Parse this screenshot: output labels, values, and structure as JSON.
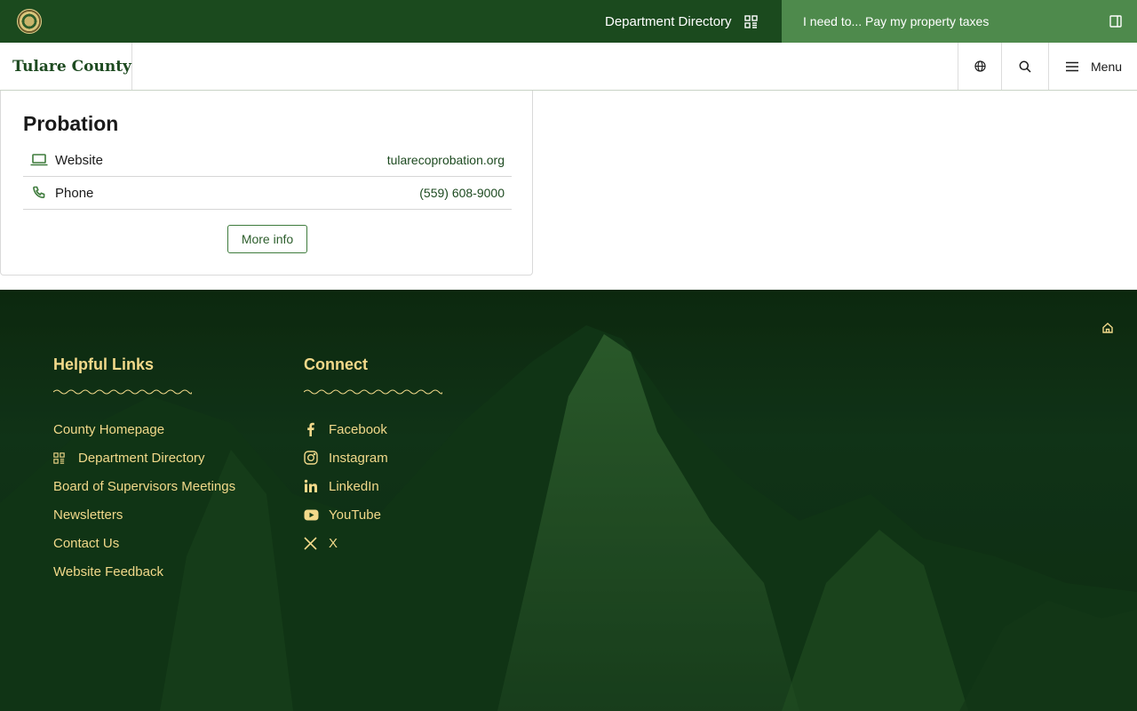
{
  "topbar": {
    "department_directory": "Department Directory",
    "i_need_to": "I need to... Pay my property taxes"
  },
  "header": {
    "brand": "Tulare County",
    "menu_label": "Menu"
  },
  "card": {
    "title": "Probation",
    "rows": [
      {
        "label": "Website",
        "value": "tularecoprobation.org",
        "icon": "laptop-icon"
      },
      {
        "label": "Phone",
        "value": "(559) 608-9000",
        "icon": "phone-icon"
      }
    ],
    "more_info": "More info"
  },
  "footer": {
    "helpful_links": {
      "heading": "Helpful Links",
      "items": [
        "County Homepage",
        "Department Directory",
        "Board of Supervisors Meetings",
        "Newsletters",
        "Contact Us",
        "Website Feedback"
      ]
    },
    "connect": {
      "heading": "Connect",
      "items": [
        "Facebook",
        "Instagram",
        "LinkedIn",
        "YouTube",
        "X"
      ]
    }
  },
  "colors": {
    "topbar": "#1b4a1e",
    "ineed_bg": "#4e8a4c",
    "brand_green": "#1d4a20",
    "footer_accent": "#f2d98a"
  }
}
